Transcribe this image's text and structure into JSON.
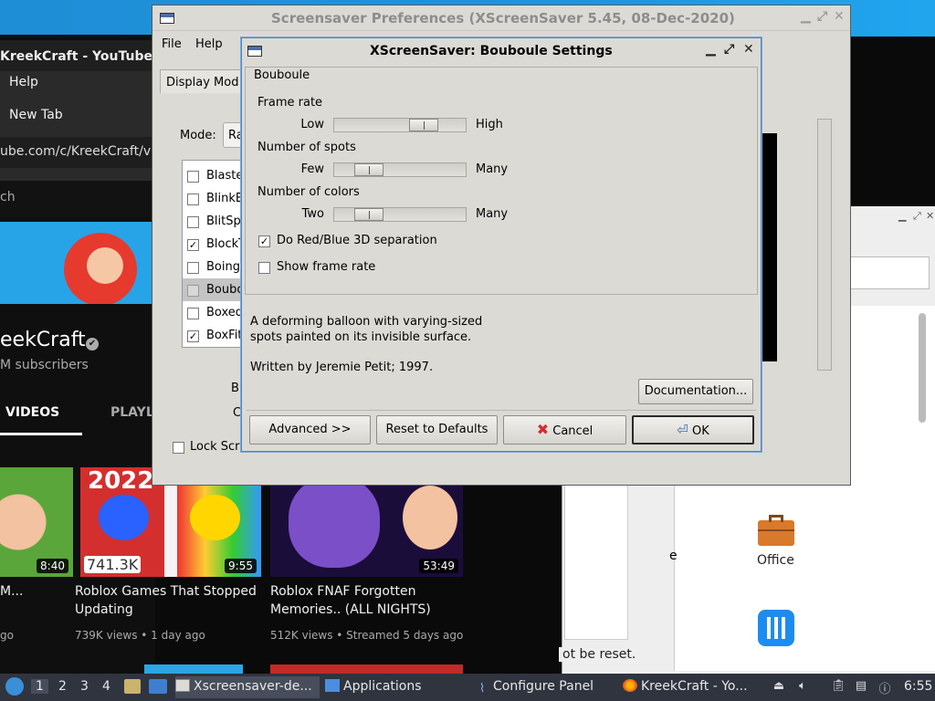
{
  "background_browser": {
    "tab_title": "KreekCraft - YouTube",
    "menu_help": "Help",
    "menu_new_tab": "New Tab",
    "url": "ube.com/c/KreekCraft/vic",
    "search_placeholder": "ch",
    "channel_name": "eekCraft",
    "verified_mark": "✔",
    "subscribers": "M subscribers",
    "tabs": [
      "VIDEOS",
      "PLAYL"
    ],
    "videos": [
      {
        "duration": "8:40",
        "title_l1": "M...",
        "title_l2": "",
        "meta": "go"
      },
      {
        "duration": "9:55",
        "overlay": "741.3K",
        "title_l1": "Roblox Games That Stopped",
        "title_l2": "Updating",
        "meta": "739K views • 1 day ago",
        "thumb_text": "2022"
      },
      {
        "duration": "53:49",
        "title_l1": "Roblox FNAF Forgotten",
        "title_l2": "Memories.. (ALL NIGHTS)",
        "meta": "512K views • Streamed 5 days ago"
      }
    ]
  },
  "right_app": {
    "office_label": "Office",
    "reset_note": "ot be reset.",
    "partial_label": "e"
  },
  "prefs_window": {
    "title": "Screensaver Preferences  (XScreenSaver 5.45, 08-Dec-2020)",
    "menu": [
      "File",
      "Help"
    ],
    "tab_label": "Display Mod",
    "mode_label": "Mode:",
    "mode_value": "Ra",
    "hacks": [
      {
        "name": "Blaste",
        "checked": false
      },
      {
        "name": "BlinkB",
        "checked": false
      },
      {
        "name": "BlitSp",
        "checked": false
      },
      {
        "name": "BlockT",
        "checked": true
      },
      {
        "name": "Boing",
        "checked": false
      },
      {
        "name": "Boubo",
        "checked": false,
        "selected": true
      },
      {
        "name": "Boxed",
        "checked": false
      },
      {
        "name": "BoxFit",
        "checked": true
      }
    ],
    "lock_label": "Lock Scr",
    "partial_bl": "Bl",
    "partial_c": "C"
  },
  "dialog": {
    "title": "XScreenSaver: Bouboule Settings",
    "frame_label": "Bouboule",
    "frame_rate": {
      "label": "Frame rate",
      "low": "Low",
      "high": "High",
      "value_fraction": 0.73
    },
    "spots": {
      "label": "Number of spots",
      "low": "Few",
      "high": "Many",
      "value_fraction": 0.2
    },
    "colors": {
      "label": "Number of colors",
      "low": "Two",
      "high": "Many",
      "value_fraction": 0.2
    },
    "checkbox_3d": {
      "label": "Do Red/Blue 3D separation",
      "checked": true
    },
    "checkbox_fps": {
      "label": "Show frame rate",
      "checked": false
    },
    "description": "A deforming balloon with varying-sized\nspots painted on its invisible surface.",
    "author": "Written by Jeremie Petit; 1997.",
    "documentation_button": "Documentation...",
    "advanced_button": "Advanced >>",
    "reset_button": "Reset to Defaults",
    "cancel_button": "Cancel",
    "ok_button": "OK"
  },
  "taskbar": {
    "workspaces": [
      "1",
      "2",
      "3",
      "4"
    ],
    "tasks": [
      "Xscreensaver-de...",
      "Applications",
      "Configure Panel",
      "KreekCraft - Yo..."
    ],
    "clock": "6:55"
  },
  "colors": {
    "taskbar_bg": "#2f343f",
    "dialog_bg": "#dcdad5",
    "dialog_border": "#4a86c8",
    "youtube_bg": "#0f0f0f"
  }
}
